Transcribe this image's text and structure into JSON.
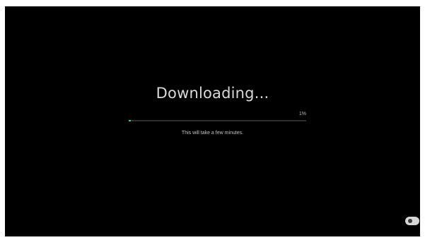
{
  "screen": {
    "title": "Downloading...",
    "progress_label": "1%",
    "progress_fraction": 0.01,
    "subtitle": "This will take a few minutes.",
    "accent_color": "#3ec6a8",
    "background_color": "#000000"
  },
  "corner_control": {
    "icon": "toggle-switch-icon"
  }
}
